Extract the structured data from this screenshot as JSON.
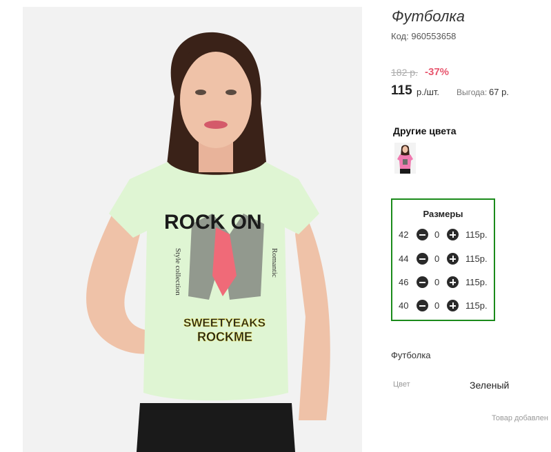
{
  "product": {
    "title": "Футболка",
    "code_label": "Код:",
    "code_value": "960553658",
    "old_price": "182 р.",
    "discount": "-37%",
    "price": "115",
    "price_unit": "р./шт.",
    "benefit_label": "Выгода:",
    "benefit_value": "67 р.",
    "image_alt": "Футболка",
    "print_text": {
      "line1": "ROCK ON",
      "line2": "SWEETYEAKS",
      "line3": "ROCKME",
      "side_left": "Style collection",
      "side_right": "Romantic"
    }
  },
  "other_colors": {
    "title": "Другие цвета",
    "thumb_name": "pink-variant"
  },
  "sizes": {
    "title": "Размеры",
    "rows": [
      {
        "size": "42",
        "qty": "0",
        "price": "115р."
      },
      {
        "size": "44",
        "qty": "0",
        "price": "115р."
      },
      {
        "size": "46",
        "qty": "0",
        "price": "115р."
      },
      {
        "size": "40",
        "qty": "0",
        "price": "115р."
      }
    ]
  },
  "details": {
    "name": "Футболка",
    "color_label": "Цвет",
    "color_value": "Зеленый",
    "added_text": "Товар добавлен"
  },
  "colors": {
    "accent_border": "#1a8a1a",
    "discount": "#e8566e",
    "shirt": "#dff5d3"
  }
}
